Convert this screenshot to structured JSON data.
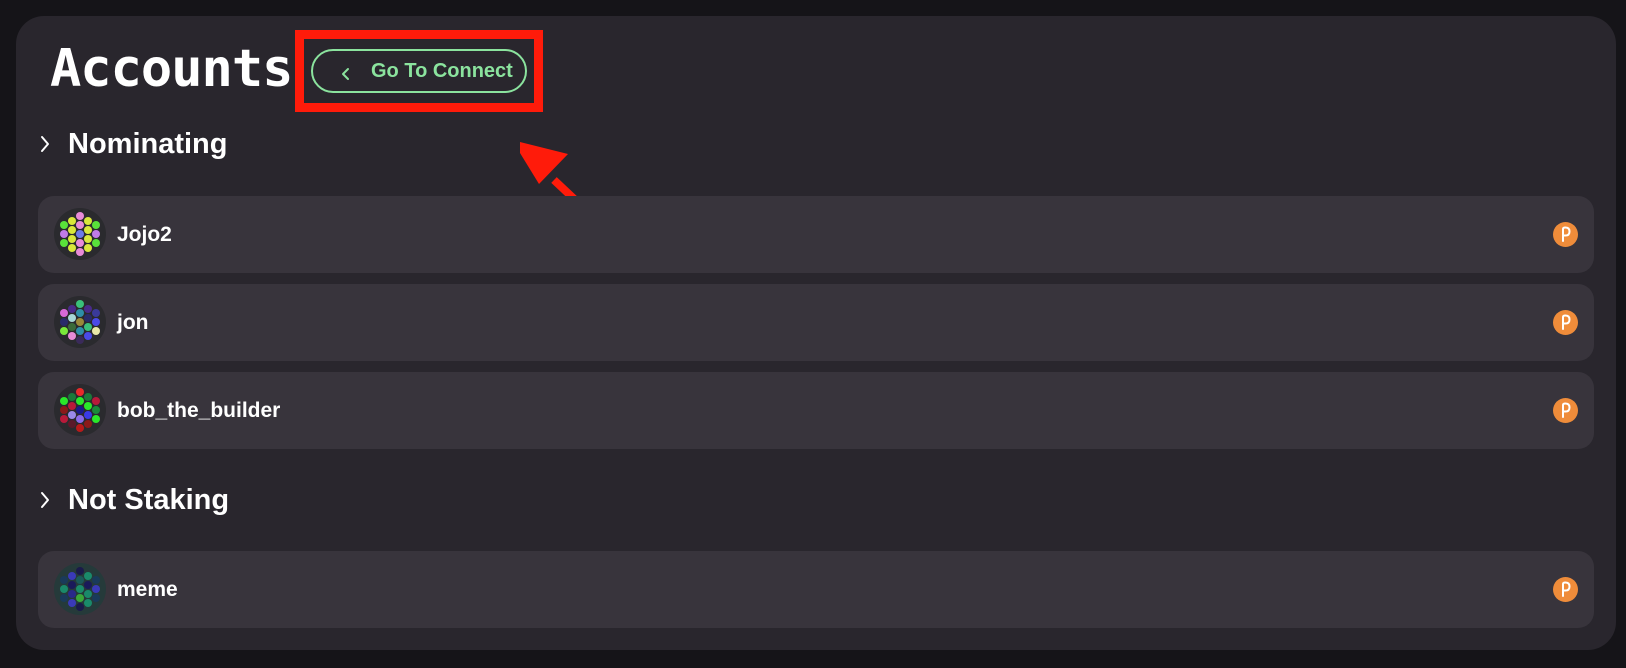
{
  "page": {
    "title": "Accounts",
    "connect_button_label": "Go To Connect"
  },
  "colors": {
    "background": "#151418",
    "panel": "#29262d",
    "row": "#38343c",
    "accent_green": "#8be39e",
    "annotation_red": "#ff1b0a",
    "network_orange": "#ef8c3a"
  },
  "sections": [
    {
      "label": "Nominating",
      "icon": "chevron-right-icon",
      "accounts": [
        {
          "name": "Jojo2",
          "network_icon": "polkadot-icon"
        },
        {
          "name": "jon",
          "network_icon": "polkadot-icon"
        },
        {
          "name": "bob_the_builder",
          "network_icon": "polkadot-icon"
        }
      ]
    },
    {
      "label": "Not Staking",
      "icon": "chevron-right-icon",
      "accounts": [
        {
          "name": "meme",
          "network_icon": "polkadot-icon"
        }
      ]
    }
  ],
  "annotations": {
    "highlight_target": "go-to-connect-button",
    "arrow": "red-arrow-pointer"
  }
}
